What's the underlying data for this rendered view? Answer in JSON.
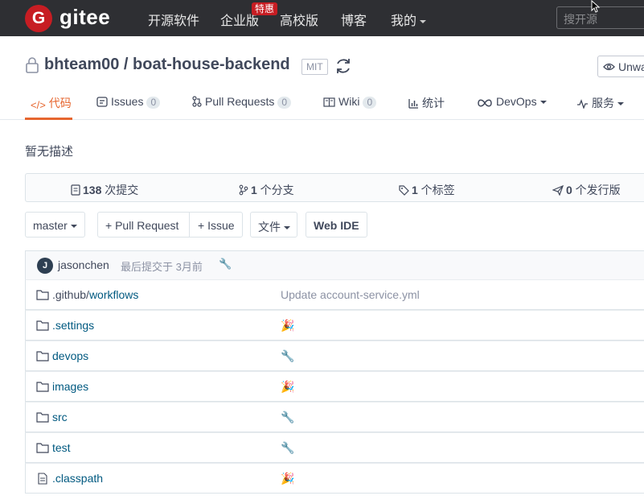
{
  "nav": {
    "logo_letter": "G",
    "logo_text": "gitee",
    "items": [
      "开源软件",
      "企业版",
      "高校版",
      "博客",
      "我的"
    ],
    "badge": "特惠",
    "search_placeholder": "搜开源"
  },
  "repo": {
    "owner": "bhteam00",
    "separator": " / ",
    "name": "boat-house-backend",
    "license": "MIT",
    "watch_label": "Unwatch"
  },
  "tabs": [
    {
      "label": "代码",
      "icon": "code-icon",
      "count": null
    },
    {
      "label": "Issues",
      "icon": "issues-icon",
      "count": "0"
    },
    {
      "label": "Pull Requests",
      "icon": "pull-request-icon",
      "count": "0"
    },
    {
      "label": "Wiki",
      "icon": "book-icon",
      "count": "0"
    },
    {
      "label": "统计",
      "icon": "chart-icon",
      "count": null
    },
    {
      "label": "DevOps",
      "icon": "infinity-icon",
      "count": null
    },
    {
      "label": "服务",
      "icon": "pulse-icon",
      "count": null
    }
  ],
  "description": "暂无描述",
  "stats": {
    "commits_num": "138",
    "commits_label": " 次提交",
    "branches_num": "1",
    "branches_label": " 个分支",
    "tags_num": "1",
    "tags_label": " 个标签",
    "releases_num": "0",
    "releases_label": " 个发行版"
  },
  "actions": {
    "branch": "master",
    "pull_request": "+ Pull Request",
    "issue": "+ Issue",
    "file": "文件",
    "web_ide": "Web IDE"
  },
  "last_commit": {
    "avatar_letter": "J",
    "author": "jasonchen",
    "time": "最后提交于 3月前",
    "message": "🔧"
  },
  "files": [
    {
      "prefix": ".github/",
      "name": "workflows",
      "type": "folder",
      "message": "Update account-service.yml"
    },
    {
      "prefix": "",
      "name": ".settings",
      "type": "folder",
      "message": "🎉"
    },
    {
      "prefix": "",
      "name": "devops",
      "type": "folder",
      "message": "🔧"
    },
    {
      "prefix": "",
      "name": "images",
      "type": "folder",
      "message": "🎉"
    },
    {
      "prefix": "",
      "name": "src",
      "type": "folder",
      "message": "🔧"
    },
    {
      "prefix": "",
      "name": "test",
      "type": "folder",
      "message": "🔧"
    },
    {
      "prefix": "",
      "name": ".classpath",
      "type": "file",
      "message": "🎉"
    }
  ],
  "colors": {
    "accent": "#e6662f",
    "brand": "#c71d23",
    "nav_bg": "#2e2f33",
    "link": "#005980"
  }
}
